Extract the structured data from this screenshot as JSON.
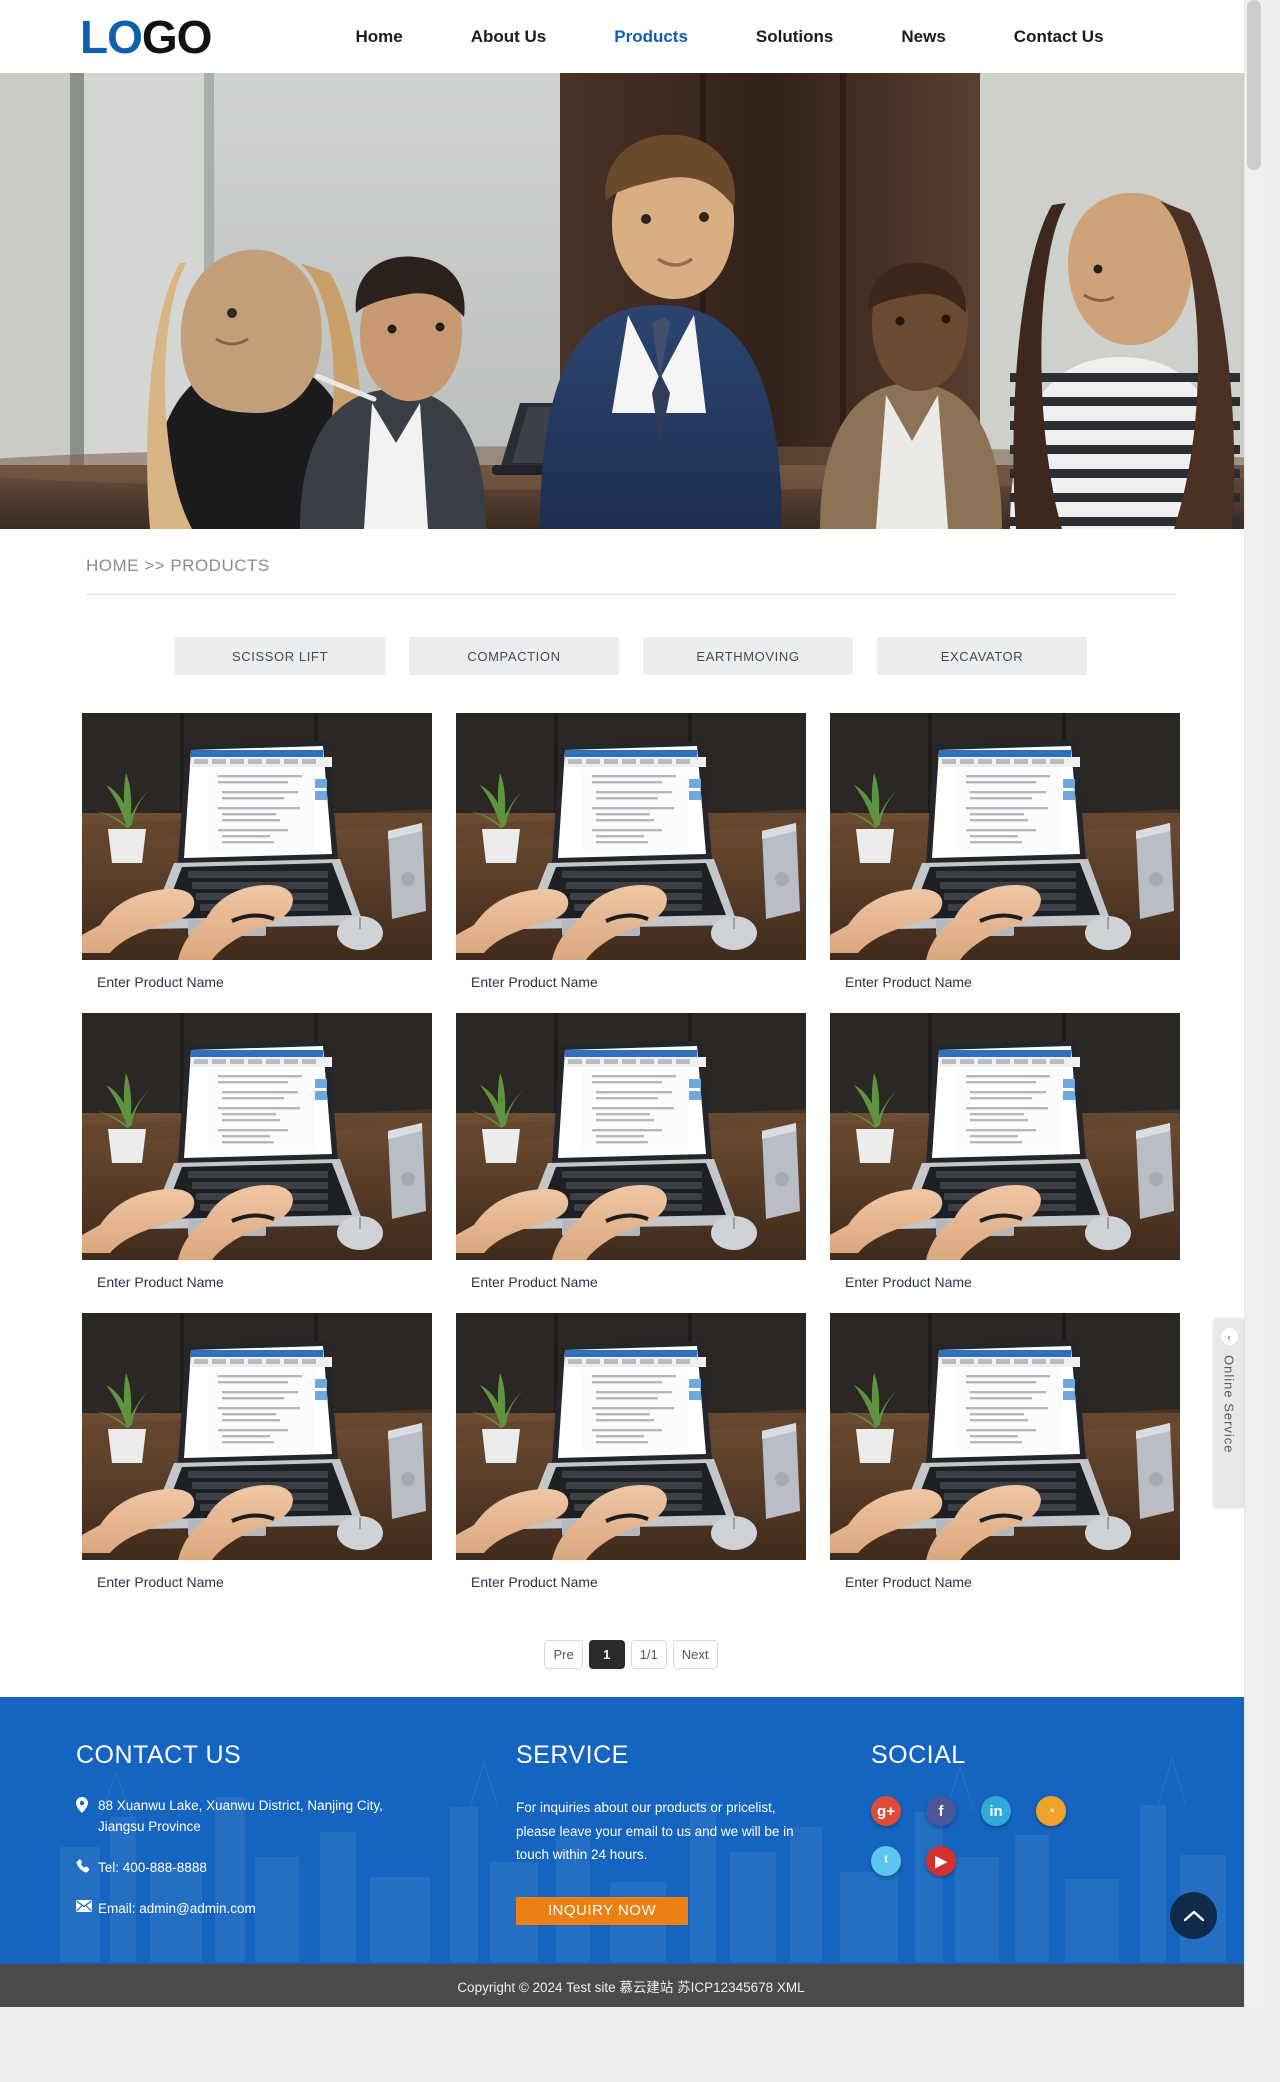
{
  "header": {
    "logo_part1": "LO",
    "logo_part2": "GO",
    "nav": [
      {
        "label": "Home",
        "active": false
      },
      {
        "label": "About Us",
        "active": false
      },
      {
        "label": "Products",
        "active": true
      },
      {
        "label": "Solutions",
        "active": false
      },
      {
        "label": "News",
        "active": false
      },
      {
        "label": "Contact Us",
        "active": false
      }
    ],
    "accent_color": "#1160b0"
  },
  "breadcrumb": {
    "home": "HOME",
    "separator": ">>",
    "current": "PRODUCTS",
    "full": "HOME >> PRODUCTS"
  },
  "categories": [
    {
      "label": "SCISSOR LIFT"
    },
    {
      "label": "COMPACTION"
    },
    {
      "label": "EARTHMOVING"
    },
    {
      "label": "EXCAVATOR"
    }
  ],
  "products": [
    {
      "title": "Enter Product Name"
    },
    {
      "title": "Enter Product Name"
    },
    {
      "title": "Enter Product Name"
    },
    {
      "title": "Enter Product Name"
    },
    {
      "title": "Enter Product Name"
    },
    {
      "title": "Enter Product Name"
    },
    {
      "title": "Enter Product Name"
    },
    {
      "title": "Enter Product Name"
    },
    {
      "title": "Enter Product Name"
    }
  ],
  "pagination": {
    "prev": "Pre",
    "current_page": "1",
    "page_of": "1/1",
    "next": "Next"
  },
  "footer": {
    "contact": {
      "title": "CONTACT US",
      "address": "88 Xuanwu Lake, Xuanwu District, Nanjing City, Jiangsu Province",
      "phone": "Tel: 400-888-8888",
      "email": "Email: admin@admin.com"
    },
    "service": {
      "title": "SERVICE",
      "description": "For inquiries about our products or pricelist, please leave your email to us and we will be in touch within 24 hours.",
      "button": "INQUIRY NOW",
      "button_color": "#eb8015"
    },
    "social": {
      "title": "SOCIAL",
      "items": [
        {
          "name": "google-plus",
          "glyph": "g+",
          "color": "#dd4b39"
        },
        {
          "name": "facebook",
          "glyph": "f",
          "color": "#4a5699"
        },
        {
          "name": "linkedin",
          "glyph": "in",
          "color": "#30a8d8"
        },
        {
          "name": "rss",
          "glyph": "◔",
          "color": "#f0a32a"
        },
        {
          "name": "twitter",
          "glyph": "ᵗ",
          "color": "#5cc6f0"
        },
        {
          "name": "youtube",
          "glyph": "▶",
          "color": "#d32f2f"
        }
      ]
    },
    "background_color": "#1565c0"
  },
  "copyright": {
    "text": "Copyright © 2024 Test site 慕云建站 苏ICP12345678 XML"
  },
  "widgets": {
    "online_service_label": "Online Service",
    "online_service_chevron": "‹",
    "scroll_top_label": "Back to top"
  }
}
